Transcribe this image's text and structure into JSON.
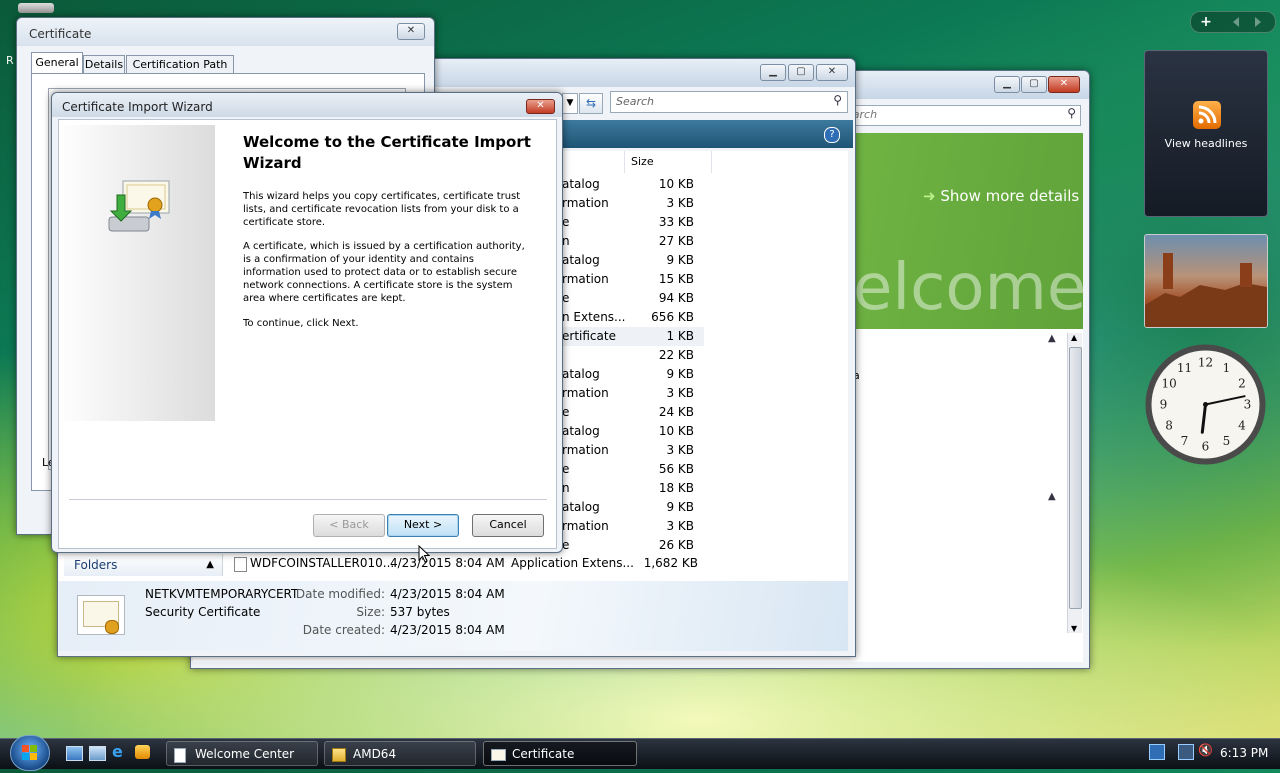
{
  "colors": {
    "taskbar": "#101820",
    "accent_blue": "#2f6eb5",
    "close_red": "#c23b22"
  },
  "sidebar": {
    "add_label": "+",
    "feed": {
      "label": "View headlines",
      "icon": "rss-icon"
    }
  },
  "cert_window": {
    "title": "Certificate",
    "tabs": [
      "General",
      "Details",
      "Certification Path"
    ],
    "left_fragment": "Le"
  },
  "explorer": {
    "search_placeholder": "Search",
    "column_size": "Size",
    "rows": [
      {
        "name": "atalog",
        "size": "10 KB"
      },
      {
        "name": "rmation",
        "size": "3 KB"
      },
      {
        "name": "e",
        "size": "33 KB"
      },
      {
        "name": "n",
        "size": "27 KB"
      },
      {
        "name": "atalog",
        "size": "9 KB"
      },
      {
        "name": "rmation",
        "size": "15 KB"
      },
      {
        "name": "e",
        "size": "94 KB"
      },
      {
        "name": "n Extens...",
        "size": "656 KB"
      },
      {
        "name": "ertificate",
        "size": "1 KB"
      },
      {
        "name": "",
        "size": "22 KB"
      },
      {
        "name": "atalog",
        "size": "9 KB"
      },
      {
        "name": "rmation",
        "size": "3 KB"
      },
      {
        "name": "e",
        "size": "24 KB"
      },
      {
        "name": "atalog",
        "size": "10 KB"
      },
      {
        "name": "rmation",
        "size": "3 KB"
      },
      {
        "name": "e",
        "size": "56 KB"
      },
      {
        "name": "n",
        "size": "18 KB"
      },
      {
        "name": "atalog",
        "size": "9 KB"
      },
      {
        "name": "rmation",
        "size": "3 KB"
      },
      {
        "name": "e",
        "size": "26 KB"
      }
    ],
    "last_row": {
      "name": "WDFCOINSTALLER010...",
      "date": "4/23/2015 8:04 AM",
      "type": "Application Extens...",
      "size": "1,682 KB"
    },
    "folders_label": "Folders",
    "details": {
      "name": "NETKVMTEMPORARYCERT",
      "type": "Security Certificate",
      "modified_label": "Date modified:",
      "modified_value": "4/23/2015 8:04 AM",
      "size_label": "Size:",
      "size_value": "537 bytes",
      "created_label": "Date created:",
      "created_value": "4/23/2015 8:04 AM"
    }
  },
  "welcome": {
    "search_placeholder": "earch",
    "show_more": "Show more details",
    "banner_text": "elcome",
    "fragment": "a"
  },
  "wizard": {
    "title": "Certificate Import Wizard",
    "heading": "Welcome to the Certificate Import Wizard",
    "para1": "This wizard helps you copy certificates, certificate trust lists, and certificate revocation lists from your disk to a certificate store.",
    "para2": "A certificate, which is issued by a certification authority, is a confirmation of your identity and contains information used to protect data or to establish secure network connections. A certificate store is the system area where certificates are kept.",
    "para3": "To continue, click Next.",
    "back_label": "< Back",
    "next_label": "Next >",
    "cancel_label": "Cancel"
  },
  "clock": {
    "hour": 6,
    "minute": 13
  },
  "taskbar": {
    "buttons": [
      "Welcome Center",
      "AMD64",
      "Certificate"
    ],
    "time": "6:13 PM"
  }
}
